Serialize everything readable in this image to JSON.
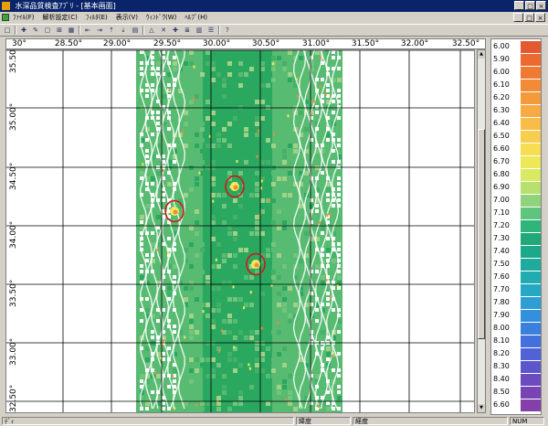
{
  "window": {
    "title": "水深品質検査ｱﾌﾟﾘ - [基本画面]",
    "controls": [
      "_",
      "□",
      "×"
    ],
    "child_controls": [
      "_",
      "□",
      "×"
    ]
  },
  "menu": [
    "ﾌｧｲﾙ(F)",
    "解析設定(C)",
    "ﾌｨﾙﾀ(E)",
    "表示(V)",
    "ｳｨﾝﾄﾞｳ(W)",
    "ﾍﾙﾌﾟ(H)"
  ],
  "toolbar": {
    "buttons": [
      {
        "name": "new-icon",
        "glyph": "□"
      },
      {
        "name": "cursor-icon",
        "glyph": "✚"
      },
      {
        "name": "zoom-icon",
        "glyph": "✎"
      },
      {
        "name": "select-icon",
        "glyph": "▢"
      },
      {
        "name": "grid-icon",
        "glyph": "⊞"
      },
      {
        "name": "table-icon",
        "glyph": "▦"
      },
      {
        "name": "move-left-icon",
        "glyph": "⇤"
      },
      {
        "name": "move-right-icon",
        "glyph": "⇥"
      },
      {
        "name": "move-up-icon",
        "glyph": "⇡"
      },
      {
        "name": "move-down-icon",
        "glyph": "⇣"
      },
      {
        "name": "filter-icon",
        "glyph": "▤"
      },
      {
        "name": "triangle-icon",
        "glyph": "△"
      },
      {
        "name": "cross-icon",
        "glyph": "✕"
      },
      {
        "name": "mark-icon",
        "glyph": "✚"
      },
      {
        "name": "list-icon",
        "glyph": "≣"
      },
      {
        "name": "column-icon",
        "glyph": "▥"
      },
      {
        "name": "rows-icon",
        "glyph": "☰"
      },
      {
        "name": "help-icon",
        "glyph": "?"
      }
    ]
  },
  "map": {
    "lon_labels": [
      "30°",
      "28.50°",
      "29.00°",
      "29.50°",
      "30.00°",
      "30.50°",
      "31.00°",
      "31.50°",
      "32.00°",
      "32.50°"
    ],
    "lat_labels": [
      "35.50°",
      "35.00°",
      "34.50°",
      "34.00°",
      "33.50°",
      "33.00°",
      "32.50°"
    ],
    "colors": {
      "grid": "#000000",
      "deep_green": "#2aa860",
      "mid_green": "#58bb72",
      "light_green": "#9fd286",
      "yellow": "#f2e85a",
      "orange": "#f08a3a",
      "red_marker": "#d01818"
    },
    "markers": 3
  },
  "legend": {
    "values": [
      "6.00",
      "5.90",
      "6.00",
      "6.10",
      "6.20",
      "6.30",
      "6.40",
      "6.50",
      "6.60",
      "6.70",
      "6.80",
      "6.90",
      "7.00",
      "7.10",
      "7.20",
      "7.30",
      "7.40",
      "7.50",
      "7.60",
      "7.70",
      "7.80",
      "7.90",
      "8.00",
      "8.10",
      "8.20",
      "8.30",
      "8.40",
      "8.50",
      "6.60"
    ],
    "colors": [
      "#e45a2e",
      "#ec6a30",
      "#f07a32",
      "#f38a36",
      "#f59a3c",
      "#f7ab42",
      "#f8bc48",
      "#f9cd4e",
      "#f6dd52",
      "#eee858",
      "#d8ea62",
      "#b8e070",
      "#8fd37a",
      "#5ec47e",
      "#2fb47c",
      "#20a878",
      "#1ea88a",
      "#1eaa9c",
      "#20acb0",
      "#26a8c4",
      "#2c9ed4",
      "#3290dc",
      "#3a80de",
      "#4470dc",
      "#5062d6",
      "#5c56cc",
      "#6a4cc0",
      "#7844b4",
      "#8440a8"
    ]
  },
  "status": {
    "ready": "ﾃﾞｨ",
    "lat": "緯度",
    "lon": "経度",
    "num": "NUM"
  }
}
